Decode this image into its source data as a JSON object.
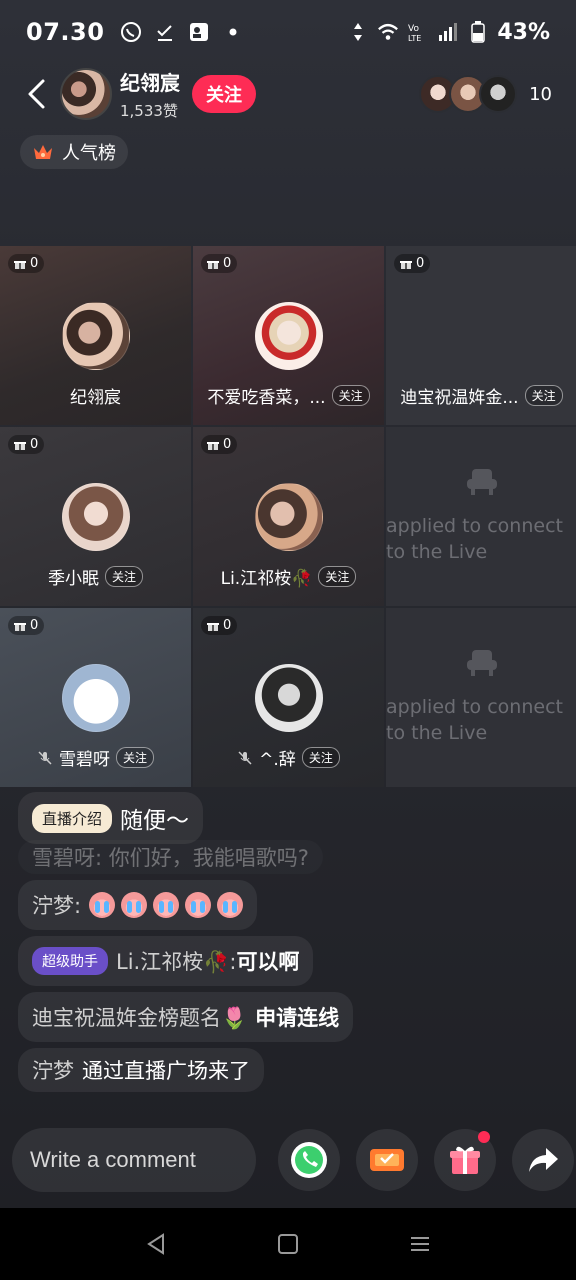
{
  "status_bar": {
    "time": "07.30",
    "battery": "43%"
  },
  "header": {
    "host_name": "纪翎宸",
    "host_likes": "1,533赞",
    "follow_label": "关注",
    "viewer_count": "10"
  },
  "popularity": {
    "label": "人气榜"
  },
  "grid": {
    "cells": [
      {
        "gifts": "0",
        "name": "纪翎宸",
        "follow": ""
      },
      {
        "gifts": "0",
        "name": "不爱吃香菜，...",
        "follow": "关注"
      },
      {
        "gifts": "0",
        "name": "迪宝祝温姩金...",
        "follow": "关注"
      },
      {
        "gifts": "0",
        "name": "季小眠",
        "follow": "关注"
      },
      {
        "gifts": "0",
        "name": "Li.江祁桉🥀",
        "follow": "关注"
      },
      {
        "applied": "applied to connect to the Live"
      },
      {
        "gifts": "0",
        "name": "雪碧呀",
        "follow": "关注"
      },
      {
        "gifts": "0",
        "name": "^.辞",
        "follow": "关注"
      },
      {
        "applied": "applied to connect to the Live"
      }
    ]
  },
  "chat": {
    "intro_tag": "直播介绍",
    "intro_text": "随便～",
    "faded_text": "雪碧呀: 你们好，我能唱歌吗?",
    "msg1_name": "泞梦:",
    "msg2_tag": "超级助手",
    "msg2_name": "Li.江祁桉🥀:",
    "msg2_text": "可以啊",
    "msg3_name": "迪宝祝温姩金榜题名🌷",
    "msg3_text": "申请连线",
    "msg4_name": "泞梦",
    "msg4_text": "通过直播广场来了"
  },
  "bottom": {
    "comment_placeholder": "Write a comment"
  }
}
